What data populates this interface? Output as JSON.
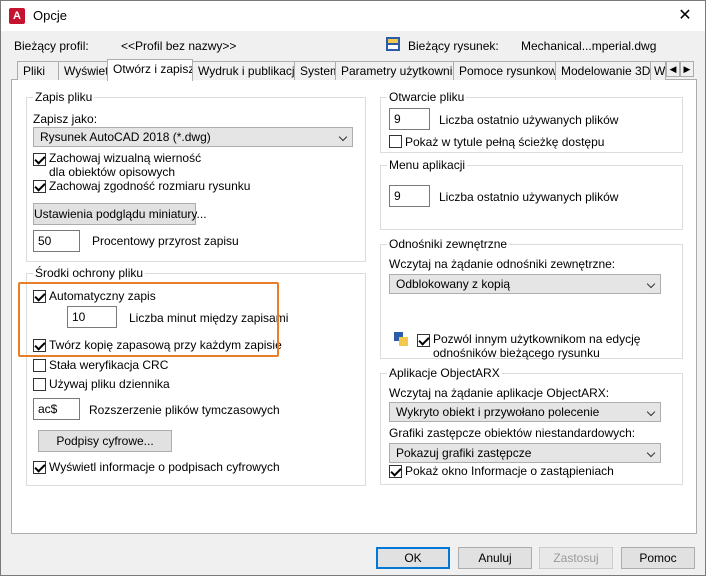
{
  "window": {
    "title": "Opcje",
    "close_glyph": "✕",
    "icon_letter": "A"
  },
  "header": {
    "profile_label": "Bieżący profil:",
    "profile_value": "<<Profil bez nazwy>>",
    "drawing_label": "Bieżący rysunek:",
    "drawing_value": "Mechanical...mperial.dwg"
  },
  "tabs": {
    "items": [
      "Pliki",
      "Wyświetl",
      "Otwórz i zapisz",
      "Wydruk i publikacja",
      "System",
      "Parametry użytkownika",
      "Pomoce rysunkowe",
      "Modelowanie 3D",
      "W"
    ],
    "active": "Otwórz i zapisz",
    "scroll_left": "◀",
    "scroll_right": "▶"
  },
  "save": {
    "title": "Zapis pliku",
    "saveas_label": "Zapisz jako:",
    "saveas_value": "Rysunek AutoCAD 2018 (*.dwg)",
    "visual_fidelity": "Zachowaj wizualną wierność dla obiektów opisowych",
    "visual_fidelity_checked": true,
    "size_compat": "Zachowaj zgodność rozmiaru rysunku",
    "size_compat_checked": true,
    "thumbnail_button": "Ustawienia podglądu miniatury...",
    "incremental_value": "50",
    "incremental_label": "Procentowy przyrost zapisu"
  },
  "safety": {
    "title": "Środki ochrony pliku",
    "autosave": "Automatyczny zapis",
    "autosave_checked": true,
    "minutes_value": "10",
    "minutes_label": "Liczba minut między zapisami",
    "backup": "Twórz kopię zapasową przy każdym zapisie",
    "backup_checked": true,
    "crc": "Stała weryfikacja CRC",
    "crc_checked": false,
    "log": "Używaj pliku dziennika",
    "log_checked": false,
    "temp_ext_value": "ac$",
    "temp_ext_label": "Rozszerzenie plików tymczasowych",
    "signatures_button": "Podpisy cyfrowe...",
    "show_signatures": "Wyświetl informacje o podpisach cyfrowych",
    "show_signatures_checked": true
  },
  "open": {
    "title": "Otwarcie pliku",
    "recent_value": "9",
    "recent_label": "Liczba ostatnio używanych plików",
    "full_path": "Pokaż w tytule pełną ścieżkę dostępu",
    "full_path_checked": false
  },
  "appmenu": {
    "title": "Menu aplikacji",
    "recent_value": "9",
    "recent_label": "Liczba ostatnio używanych plików"
  },
  "xref": {
    "title": "Odnośniki zewnętrzne",
    "demand_label": "Wczytaj na żądanie odnośniki zewnętrzne:",
    "demand_value": "Odblokowany z kopią",
    "allow_edit": "Pozwól innym użytkownikom na edycję odnośników bieżącego rysunku",
    "allow_edit_checked": true
  },
  "arx": {
    "title": "Aplikacje ObjectARX",
    "demand_label": "Wczytaj na żądanie aplikacje ObjectARX:",
    "demand_value": "Wykryto obiekt i przywołano polecenie",
    "proxy_label": "Grafiki zastępcze obiektów niestandardowych:",
    "proxy_value": "Pokazuj grafiki zastępcze",
    "proxy_info": "Pokaż okno Informacje o zastąpieniach",
    "proxy_info_checked": true
  },
  "footer": {
    "ok": "OK",
    "cancel": "Anuluj",
    "apply": "Zastosuj",
    "help": "Pomoc"
  },
  "colors": {
    "highlight": "#e87e27",
    "focus": "#0078d7",
    "brand": "#c4122f"
  }
}
